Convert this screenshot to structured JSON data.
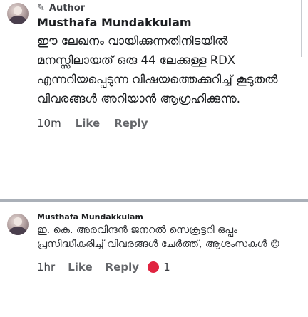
{
  "comment1": {
    "author_badge": "Author",
    "name": "Musthafa Mundakkulam",
    "body": "ഈ ലേഖനം വായിക്കുന്നതിനിടയിൽ മനസ്സിലായത് ഒരു 44 ലേക്കുള്ള RDX എന്നറിയപ്പെടുന്ന വിഷയത്തെക്കുറിച്ച് കൂടുതൽ വിവരങ്ങൾ അറിയാൻ ആഗ്രഹിക്കുന്നു.",
    "time": "10m",
    "like": "Like",
    "reply": "Reply"
  },
  "comment2": {
    "name": "Musthafa Mundakkulam",
    "body": "ഇ. കെ. അരവിന്ദൻ ജനറൽ സെക്രട്ടറി ഒപ്പം പ്രസിദ്ധീകരിച്ച് വിവരങ്ങൾ ചേർത്ത്, ആശംസകൾ",
    "emoji": "😊",
    "time": "1hr",
    "like": "Like",
    "reply": "Reply",
    "reaction_count": "1"
  },
  "colors": {
    "reaction": "#e02440",
    "divider": "#aab0b8",
    "muted": "#65676b"
  }
}
